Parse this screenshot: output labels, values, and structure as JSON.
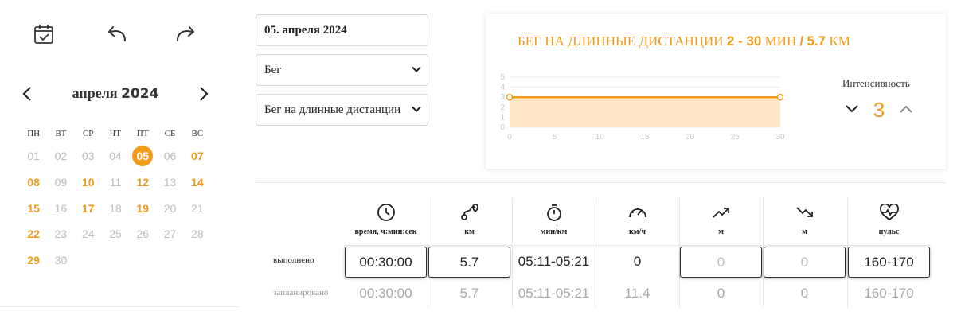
{
  "toolbar": {
    "calendar_icon": "calendar-check-icon",
    "undo_icon": "undo-icon",
    "redo_icon": "redo-icon"
  },
  "calendar": {
    "month": "апреля",
    "year": "2024",
    "weekdays": [
      "ПН",
      "ВТ",
      "СР",
      "ЧТ",
      "ПТ",
      "СБ",
      "ВС"
    ],
    "weeks": [
      [
        {
          "d": "01",
          "s": "muted"
        },
        {
          "d": "02",
          "s": "muted"
        },
        {
          "d": "03",
          "s": "muted"
        },
        {
          "d": "04",
          "s": "muted"
        },
        {
          "d": "05",
          "s": "selected"
        },
        {
          "d": "06",
          "s": "muted"
        },
        {
          "d": "07",
          "s": "active"
        }
      ],
      [
        {
          "d": "08",
          "s": "active"
        },
        {
          "d": "09",
          "s": "muted"
        },
        {
          "d": "10",
          "s": "active"
        },
        {
          "d": "11",
          "s": "muted"
        },
        {
          "d": "12",
          "s": "active"
        },
        {
          "d": "13",
          "s": "muted"
        },
        {
          "d": "14",
          "s": "active"
        }
      ],
      [
        {
          "d": "15",
          "s": "active"
        },
        {
          "d": "16",
          "s": "muted"
        },
        {
          "d": "17",
          "s": "active"
        },
        {
          "d": "18",
          "s": "muted"
        },
        {
          "d": "19",
          "s": "active"
        },
        {
          "d": "20",
          "s": "muted"
        },
        {
          "d": "21",
          "s": "muted"
        }
      ],
      [
        {
          "d": "22",
          "s": "active"
        },
        {
          "d": "23",
          "s": "muted"
        },
        {
          "d": "24",
          "s": "muted"
        },
        {
          "d": "25",
          "s": "muted"
        },
        {
          "d": "26",
          "s": "muted"
        },
        {
          "d": "27",
          "s": "muted"
        },
        {
          "d": "28",
          "s": "muted"
        }
      ],
      [
        {
          "d": "29",
          "s": "active"
        },
        {
          "d": "30",
          "s": "muted"
        }
      ]
    ],
    "colors": {
      "accent": "#f19b1a",
      "muted": "#bdbdbd"
    }
  },
  "form": {
    "date_value": "05. апреля 2024",
    "sport_value": "Бег",
    "workout_value": "Бег на длинные дистанции"
  },
  "chart_card": {
    "title_prefix": "БЕГ НА ДЛИННЫЕ ДИСТАНЦИИ",
    "title_range": "2 - 30",
    "title_unit": "МИН",
    "title_sep": "/",
    "title_distance": "5.7",
    "title_distance_unit": "КМ",
    "intensity_label": "Интенсивность",
    "intensity_value": "3"
  },
  "chart_data": {
    "type": "area",
    "x": [
      0,
      30
    ],
    "y": [
      3,
      3
    ],
    "xticks": [
      "0",
      "5",
      "10",
      "15",
      "20",
      "25",
      "30"
    ],
    "yticks": [
      "0",
      "1",
      "2",
      "3",
      "4",
      "5"
    ],
    "xlim": [
      0,
      30
    ],
    "ylim": [
      0,
      5
    ],
    "grid": true,
    "line_color": "#f19b1a",
    "fill_color": "#fde3bd"
  },
  "metrics": {
    "columns": [
      {
        "icon": "clock-icon",
        "label": "время, ч:мин:сек"
      },
      {
        "icon": "route-icon",
        "label": "км"
      },
      {
        "icon": "stopwatch-icon",
        "label": "мин/км"
      },
      {
        "icon": "speedometer-icon",
        "label": "км/ч"
      },
      {
        "icon": "trend-up-icon",
        "label": "м"
      },
      {
        "icon": "trend-down-icon",
        "label": "м"
      },
      {
        "icon": "heart-pulse-icon",
        "label": "пульс"
      }
    ],
    "done_label": "выполнено",
    "planned_label": "запланировано",
    "done": [
      "00:30:00",
      "5.7",
      "05:11-05:21",
      "0",
      "0",
      "0",
      "160-170"
    ],
    "planned": [
      "00:30:00",
      "5.7",
      "05:11-05:21",
      "11.4",
      "0",
      "0",
      "160-170"
    ]
  }
}
